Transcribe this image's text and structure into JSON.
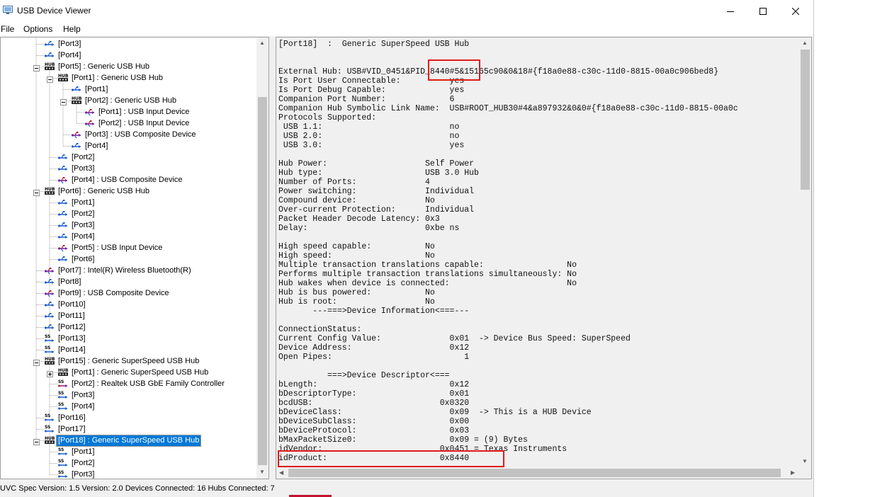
{
  "window": {
    "title": "USB Device Viewer"
  },
  "menu": [
    "File",
    "Options",
    "Help"
  ],
  "tree": [
    {
      "label": "[Port3]",
      "indent": 2,
      "icon": "usb-port-icon"
    },
    {
      "label": "[Port4]",
      "indent": 2,
      "icon": "usb-port-icon"
    },
    {
      "label": "[Port5]  :  Generic USB Hub",
      "indent": 2,
      "icon": "usb-hub-icon",
      "expanded": true
    },
    {
      "label": "[Port1]  :  Generic USB Hub",
      "indent": 3,
      "icon": "usb-hub-icon",
      "expanded": true
    },
    {
      "label": "[Port1]",
      "indent": 4,
      "icon": "usb-port-icon"
    },
    {
      "label": "[Port2]  :  Generic USB Hub",
      "indent": 4,
      "icon": "usb-hub-icon",
      "expanded": true
    },
    {
      "label": "[Port1]  :  USB Input Device",
      "indent": 5,
      "icon": "usb-device-icon"
    },
    {
      "label": "[Port2]  :  USB Input Device",
      "indent": 5,
      "icon": "usb-device-icon"
    },
    {
      "label": "[Port3]  :  USB Composite Device",
      "indent": 4,
      "icon": "usb-device-icon"
    },
    {
      "label": "[Port4]",
      "indent": 4,
      "icon": "usb-port-icon"
    },
    {
      "label": "[Port2]",
      "indent": 3,
      "icon": "usb-port-icon"
    },
    {
      "label": "[Port3]",
      "indent": 3,
      "icon": "usb-port-icon"
    },
    {
      "label": "[Port4]  :  USB Composite Device",
      "indent": 3,
      "icon": "usb-device-icon"
    },
    {
      "label": "[Port6]  :  Generic USB Hub",
      "indent": 2,
      "icon": "usb-hub-icon",
      "expanded": true
    },
    {
      "label": "[Port1]",
      "indent": 3,
      "icon": "usb-port-icon"
    },
    {
      "label": "[Port2]",
      "indent": 3,
      "icon": "usb-port-icon"
    },
    {
      "label": "[Port3]",
      "indent": 3,
      "icon": "usb-port-icon"
    },
    {
      "label": "[Port4]",
      "indent": 3,
      "icon": "usb-port-icon"
    },
    {
      "label": "[Port5]  :  USB Input Device",
      "indent": 3,
      "icon": "usb-device-icon"
    },
    {
      "label": "[Port6]",
      "indent": 3,
      "icon": "usb-port-icon"
    },
    {
      "label": "[Port7]  :  Intel(R) Wireless Bluetooth(R)",
      "indent": 2,
      "icon": "usb-device-icon"
    },
    {
      "label": "[Port8]",
      "indent": 2,
      "icon": "usb-port-icon"
    },
    {
      "label": "[Port9]  :  USB Composite Device",
      "indent": 2,
      "icon": "usb-device-icon"
    },
    {
      "label": "[Port10]",
      "indent": 2,
      "icon": "usb-port-icon"
    },
    {
      "label": "[Port11]",
      "indent": 2,
      "icon": "usb-port-icon"
    },
    {
      "label": "[Port12]",
      "indent": 2,
      "icon": "usb-port-icon"
    },
    {
      "label": "[Port13]",
      "indent": 2,
      "icon": "ss-port-icon"
    },
    {
      "label": "[Port14]",
      "indent": 2,
      "icon": "ss-port-icon"
    },
    {
      "label": "[Port15]  :  Generic SuperSpeed USB Hub",
      "indent": 2,
      "icon": "usb-hub-icon",
      "expanded": true
    },
    {
      "label": "[Port1]  :  Generic SuperSpeed USB Hub",
      "indent": 3,
      "icon": "usb-hub-icon",
      "collapsed": true
    },
    {
      "label": "[Port2]  :  Realtek USB GbE Family Controller",
      "indent": 3,
      "icon": "ss-device-icon"
    },
    {
      "label": "[Port3]",
      "indent": 3,
      "icon": "ss-port-icon"
    },
    {
      "label": "[Port4]",
      "indent": 3,
      "icon": "ss-port-icon"
    },
    {
      "label": "[Port16]",
      "indent": 2,
      "icon": "ss-port-icon"
    },
    {
      "label": "[Port17]",
      "indent": 2,
      "icon": "ss-port-icon"
    },
    {
      "label": "[Port18]  :  Generic SuperSpeed USB Hub",
      "indent": 2,
      "icon": "usb-hub-icon",
      "expanded": true,
      "selected": true
    },
    {
      "label": "[Port1]",
      "indent": 3,
      "icon": "ss-port-icon"
    },
    {
      "label": "[Port2]",
      "indent": 3,
      "icon": "ss-port-icon"
    },
    {
      "label": "[Port3]",
      "indent": 3,
      "icon": "ss-port-icon"
    }
  ],
  "details": [
    "[Port18]  :  Generic SuperSpeed USB Hub",
    "",
    "",
    "External Hub: USB#VID_0451&PID_8440#5&15165c90&0&18#{f18a0e88-c30c-11d0-8815-00a0c906bed8}",
    "Is Port User Connectable:          yes",
    "Is Port Debug Capable:             yes",
    "Companion Port Number:             6",
    "Companion Hub Symbolic Link Name:  USB#ROOT_HUB30#4&a897932&0&0#{f18a0e88-c30c-11d0-8815-00a0c",
    "Protocols Supported:",
    " USB 1.1:                          no",
    " USB 2.0:                          no",
    " USB 3.0:                          yes",
    "",
    "Hub Power:                    Self Power",
    "Hub type:                     USB 3.0 Hub",
    "Number of Ports:              4",
    "Power switching:              Individual",
    "Compound device:              No",
    "Over-current Protection:      Individual",
    "Packet Header Decode Latency: 0x3",
    "Delay:                        0xbe ns",
    "",
    "High speed capable:           No",
    "High speed:                   No",
    "Multiple transaction translations capable:                 No",
    "Performs multiple transaction translations simultaneously: No",
    "Hub wakes when device is connected:                        No",
    "Hub is bus powered:           No",
    "Hub is root:                  No",
    "       ---===>Device Information<===---",
    "",
    "ConnectionStatus:",
    "Current Config Value:              0x01  -> Device Bus Speed: SuperSpeed",
    "Device Address:                    0x12",
    "Open Pipes:                           1",
    "",
    "          ===>Device Descriptor<===",
    "bLength:                           0x12",
    "bDescriptorType:                   0x01",
    "bcdUSB:                          0x0320",
    "bDeviceClass:                      0x09  -> This is a HUB Device",
    "bDeviceSubClass:                   0x00",
    "bDeviceProtocol:                   0x03",
    "bMaxPacketSize0:                   0x09 = (9) Bytes",
    "idVendor:                        0x0451 = Texas Instruments",
    "idProduct:                       0x8440"
  ],
  "status": "UVC Spec Version: 1.5 Version: 2.0 Devices Connected: 16   Hubs Connected: 7",
  "colors": {
    "selection": "#0078d7",
    "highlight": "#e01b1b"
  }
}
